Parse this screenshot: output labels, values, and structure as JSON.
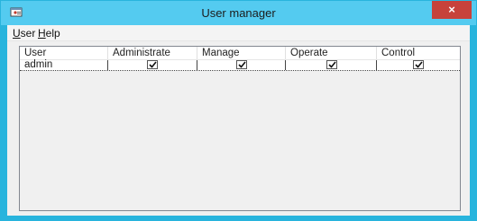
{
  "window": {
    "title": "User manager",
    "close_glyph": "×",
    "icon": "user-manager-app-icon",
    "accent_color": "#54cbf0",
    "close_color": "#c7423b"
  },
  "menu": {
    "items": [
      {
        "label": "User",
        "mnemonic": "U",
        "rest": "ser"
      },
      {
        "label": "Help",
        "mnemonic": "H",
        "rest": "elp"
      }
    ]
  },
  "table": {
    "columns": [
      "User",
      "Administrate",
      "Manage",
      "Operate",
      "Control"
    ],
    "rows": [
      {
        "user": "admin",
        "administrate": true,
        "manage": true,
        "operate": true,
        "control": true
      }
    ]
  }
}
